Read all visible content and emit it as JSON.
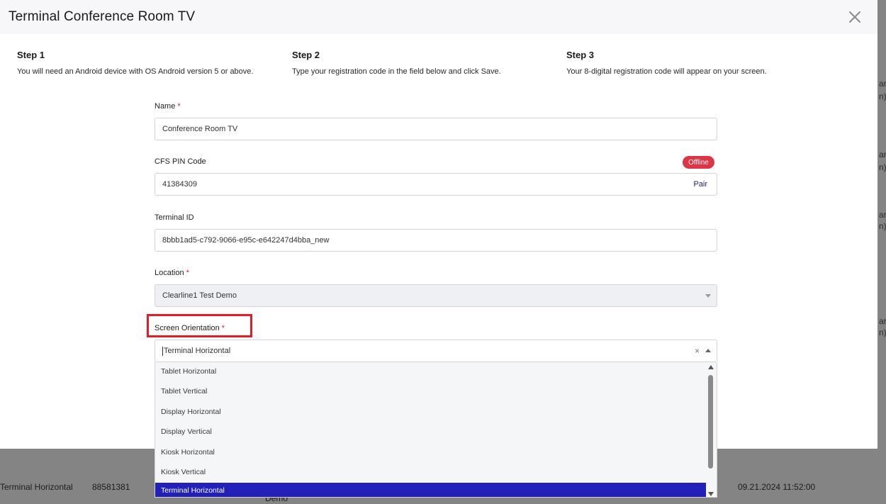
{
  "modal": {
    "title": "Terminal Conference Room TV",
    "close_icon": "close-icon"
  },
  "steps": [
    {
      "title": "Step 1",
      "description": "You will need an Android device with OS Android version 5 or above."
    },
    {
      "title": "Step 2",
      "description": "Type your registration code in the field below and click Save."
    },
    {
      "title": "Step 3",
      "description": "Your 8-digital registration code will appear on your screen."
    }
  ],
  "form": {
    "name": {
      "label": "Name",
      "required_mark": "*",
      "value": "Conference Room TV"
    },
    "pin": {
      "label": "CFS PIN Code",
      "value": "41384309",
      "pair_label": "Pair",
      "status": "Offline",
      "status_color": "#dc3545"
    },
    "terminal_id": {
      "label": "Terminal ID",
      "value": "8bbb1ad5-c792-9066-e95c-e642247d4bba_new"
    },
    "location": {
      "label": "Location",
      "required_mark": "*",
      "value": "Clearline1 Test Demo"
    },
    "orientation": {
      "label": "Screen Orientation",
      "required_mark": "*",
      "value": "Terminal Horizontal",
      "clear_icon": "×",
      "options": [
        "Tablet Horizontal",
        "Tablet Vertical",
        "Display Horizontal",
        "Display Vertical",
        "Kiosk Horizontal",
        "Kiosk Vertical",
        "Terminal Horizontal"
      ],
      "selected_index": 6
    }
  },
  "background_row": {
    "orientation": "Terminal Horizontal",
    "pin": "88581381",
    "location_fragment": "Demo",
    "datetime": "09.21.2024 11:52:00"
  },
  "background_fragments": [
    "ar",
    "n)",
    "ar",
    "n)",
    "ar",
    "n)",
    "ar",
    "n)"
  ],
  "colors": {
    "accent": "#2320b9",
    "highlight": "#e01e26",
    "required": "#d0212c",
    "overlay": "#7f7f80"
  }
}
